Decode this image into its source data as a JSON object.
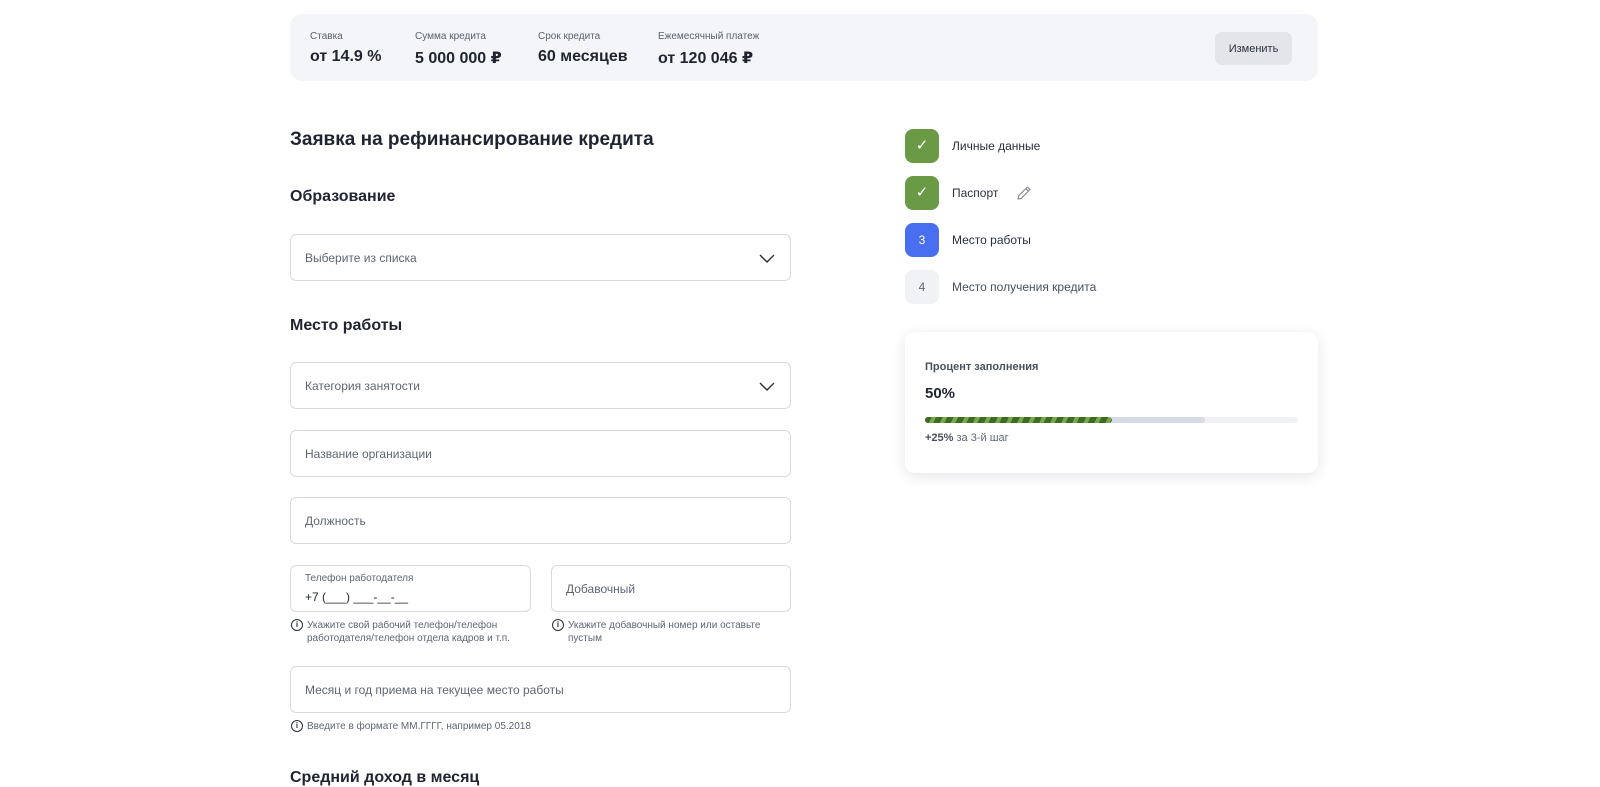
{
  "summary": {
    "items": [
      {
        "label": "Ставка",
        "value": "от 14.9 %"
      },
      {
        "label": "Сумма кредита",
        "value": "5 000 000 ₽"
      },
      {
        "label": "Срок кредита",
        "value": "60 месяцев"
      },
      {
        "label": "Ежемесячный платеж",
        "value": "от 120 046 ₽"
      }
    ],
    "change_label": "Изменить"
  },
  "form": {
    "title": "Заявка на рефинансирование кредита",
    "education": {
      "title": "Образование",
      "select_placeholder": "Выберите из списка"
    },
    "work": {
      "title": "Место работы",
      "category_placeholder": "Категория занятости",
      "org_placeholder": "Название организации",
      "position_placeholder": "Должность",
      "phone_label": "Телефон работодателя",
      "phone_value": "+7 (___) ___-__-__",
      "extension_placeholder": "Добавочный",
      "phone_hint": "Укажите свой рабочий телефон/телефон работодателя/телефон отдела кадров и т.п.",
      "extension_hint": "Укажите добавочный номер или оставьте пустым",
      "hire_date_placeholder": "Месяц и год приема на текущее место работы",
      "hire_date_hint": "Введите в формате ММ.ГГГГ, например 05.2018"
    },
    "income": {
      "title": "Средний доход в месяц"
    }
  },
  "steps": [
    {
      "badge": "✓",
      "label": "Личные данные",
      "status": "done"
    },
    {
      "badge": "✓",
      "label": "Паспорт",
      "status": "done"
    },
    {
      "badge": "3",
      "label": "Место работы",
      "status": "active"
    },
    {
      "badge": "4",
      "label": "Место получения кредита",
      "status": "todo"
    }
  ],
  "progress": {
    "title": "Процент заполнения",
    "value_label": "50%",
    "fill_fraction": 0.5,
    "next_fraction": 0.75,
    "note_bold": "+25%",
    "note_rest": " за 3-й шаг"
  },
  "icons": {
    "chevron": "chevron-down-icon",
    "info": "info-icon",
    "check": "check-icon",
    "pencil": "pencil-icon"
  },
  "colors": {
    "done": "#6b9a47",
    "active": "#4a6ef0",
    "progress": "#4f7f31"
  }
}
